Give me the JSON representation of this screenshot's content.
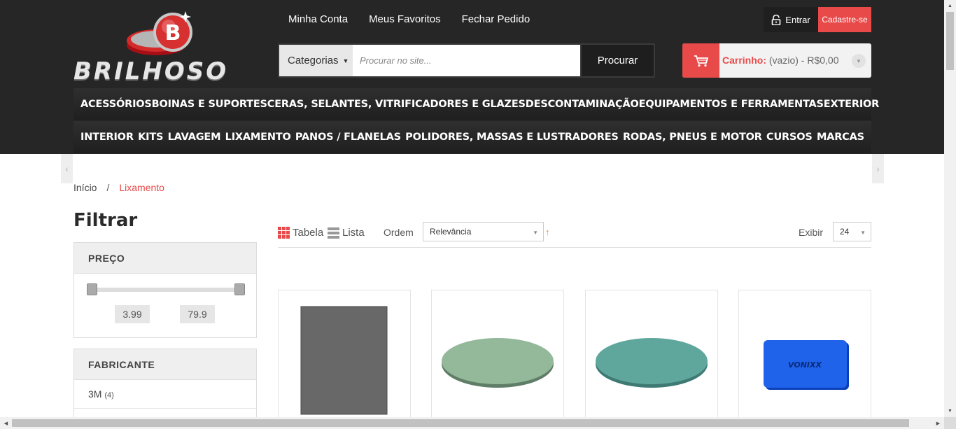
{
  "logo": {
    "text": "BRILHOSO",
    "letter": "B"
  },
  "top_links": [
    "Minha Conta",
    "Meus Favoritos",
    "Fechar Pedido"
  ],
  "account": {
    "login_label": "Entrar",
    "signup_label": "Cadastre-se"
  },
  "search": {
    "category_label": "Categorias",
    "placeholder": "Procurar no site...",
    "button_label": "Procurar"
  },
  "cart": {
    "label": "Carrinho:",
    "status": "(vazio) - R$0,00"
  },
  "nav_row1": [
    "ACESSÓRIOS",
    "BOINAS E SUPORTES",
    "CERAS, SELANTES, VITRIFICADORES E GLAZES",
    "DESCONTAMINAÇÃO",
    "EQUIPAMENTOS E FERRAMENTAS",
    "EXTERIOR"
  ],
  "nav_row2": [
    "INTERIOR",
    "KITS",
    "LAVAGEM",
    "LIXAMENTO",
    "PANOS / FLANELAS",
    "POLIDORES, MASSAS E LUSTRADORES",
    "RODAS, PNEUS E MOTOR",
    "CURSOS",
    "MARCAS"
  ],
  "breadcrumb": {
    "home": "Início",
    "sep": "/",
    "current": "Lixamento"
  },
  "filter": {
    "title": "Filtrar",
    "price": {
      "heading": "PREÇO",
      "min": "3.99",
      "max": "79.9"
    },
    "brand": {
      "heading": "FABRICANTE",
      "items": [
        {
          "name": "3M",
          "count": "(4)"
        }
      ]
    }
  },
  "toolbar": {
    "table_label": "Tabela",
    "list_label": "Lista",
    "order_label": "Ordem",
    "order_value": "Relevância",
    "show_label": "Exibir",
    "show_value": "24"
  },
  "products": [
    {
      "image": "gray-sandpaper-sheet"
    },
    {
      "image": "green-sanding-disc"
    },
    {
      "image": "teal-sanding-disc"
    },
    {
      "image": "vonixx-blue-block",
      "brand_print": "VONIXX"
    }
  ],
  "colors": {
    "accent": "#e84a4a",
    "header_bg": "#262626"
  }
}
